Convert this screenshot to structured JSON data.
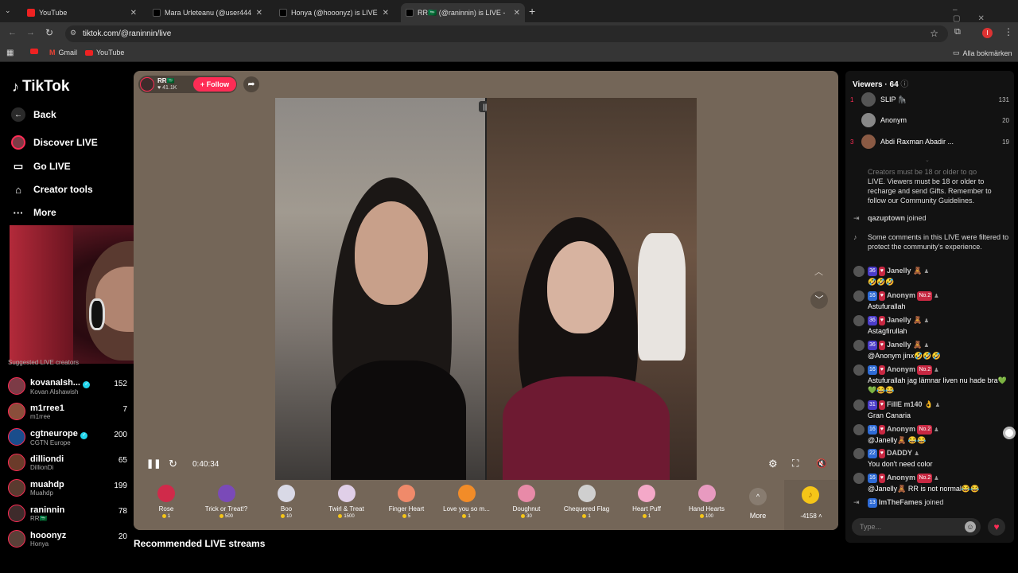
{
  "browser": {
    "tabs": [
      {
        "title": "YouTube",
        "fav": "#e22"
      },
      {
        "title": "Mara Urleteanu (@user444",
        "fav": "#222"
      },
      {
        "title": "Honya (@hooonyz) is LIVE",
        "fav": "#222"
      },
      {
        "title": "RR🇸🇦 (@raninnin) is LIVE -",
        "fav": "#222"
      }
    ],
    "url": "tiktok.com/@raninnin/live",
    "bookmarks": [
      "Gmail",
      "YouTube"
    ],
    "all_bookmarks": "Alla bokmärken",
    "profile_initial": "I"
  },
  "sidebar": {
    "logo": "TikTok",
    "back": "Back",
    "items": [
      "Discover LIVE",
      "Go LIVE",
      "Creator tools",
      "More"
    ],
    "suggested_header": "Suggested LIVE creators",
    "creators": [
      {
        "name": "kovanalsh...",
        "sub": "Kovan Alshawish",
        "count": "152",
        "verified": true,
        "color": "#7c3b46"
      },
      {
        "name": "m1rree1",
        "sub": "m1rree",
        "count": "7",
        "verified": false,
        "color": "#8a4e3b"
      },
      {
        "name": "cgtneurope",
        "sub": "CGTN Europe",
        "count": "200",
        "verified": true,
        "color": "#1a4d8c"
      },
      {
        "name": "dilliondi",
        "sub": "DillionDi",
        "count": "65",
        "verified": false,
        "color": "#6b3b2a"
      },
      {
        "name": "muahdp",
        "sub": "Muahdp",
        "count": "199",
        "verified": false,
        "color": "#5a3a2f"
      },
      {
        "name": "raninnin",
        "sub": "RR🇸🇦",
        "count": "78",
        "verified": false,
        "color": "#3e2b2b"
      },
      {
        "name": "hooonyz",
        "sub": "Honya",
        "count": "20",
        "verified": false,
        "color": "#5a4038"
      }
    ]
  },
  "player": {
    "host_name": "RR🇸🇦",
    "host_likes": "41.1K",
    "follow": "+ Follow",
    "time": "0:40:34",
    "recommended": "Recommended LIVE streams",
    "coins": "-4158",
    "gifts": [
      {
        "name": "Rose",
        "price": "1",
        "color": "#d02a4a"
      },
      {
        "name": "Trick or Treat!?",
        "price": "500",
        "color": "#7a4ab8"
      },
      {
        "name": "Boo",
        "price": "10",
        "color": "#d9d9e6"
      },
      {
        "name": "Twirl & Treat",
        "price": "1500",
        "color": "#e0cfe8"
      },
      {
        "name": "Finger Heart",
        "price": "5",
        "color": "#f08a6a"
      },
      {
        "name": "Love you so m...",
        "price": "1",
        "color": "#f28c28"
      },
      {
        "name": "Doughnut",
        "price": "30",
        "color": "#e88aa8"
      },
      {
        "name": "Chequered Flag",
        "price": "1",
        "color": "#cfcfcf"
      },
      {
        "name": "Heart Puff",
        "price": "1",
        "color": "#f4a8c8"
      },
      {
        "name": "Hand Hearts",
        "price": "100",
        "color": "#e89ac0"
      }
    ],
    "more": "More"
  },
  "chat": {
    "viewers_label": "Viewers · 64",
    "top_viewers": [
      {
        "rank": "1",
        "name": "SLIP 🦍",
        "value": "131",
        "color": "#555"
      },
      {
        "rank": "",
        "name": "Anonym",
        "value": "20",
        "color": "#888"
      },
      {
        "rank": "3",
        "name": "Abdi Raxman Abadir ...",
        "value": "19",
        "color": "#8a5a44"
      }
    ],
    "notice_faded": "Creators must be 18 or older to go",
    "notice": "LIVE. Viewers must be 18 or older to recharge and send Gifts. Remember to follow our Community Guidelines.",
    "messages": [
      {
        "kind": "join",
        "user": "qazuptown",
        "text": "joined"
      },
      {
        "kind": "system",
        "text": "Some comments in this LIVE were filtered to protect the community's experience."
      },
      {
        "kind": "msg",
        "lvl": "36",
        "user": "Janelly 🧸",
        "no": "",
        "text": "🤣🤣🤣"
      },
      {
        "kind": "msg",
        "lvl": "16",
        "user": "Anonym",
        "no": "No.2",
        "text": "Astufurallah"
      },
      {
        "kind": "msg",
        "lvl": "36",
        "user": "Janelly 🧸",
        "no": "",
        "text": "Astagfirullah"
      },
      {
        "kind": "msg",
        "lvl": "36",
        "user": "Janelly 🧸",
        "no": "",
        "text": "@Anonym jinx🤣🤣🤣"
      },
      {
        "kind": "msg",
        "lvl": "16",
        "user": "Anonym",
        "no": "No.2",
        "text": "Astufurallah jag lämnar liven nu hade bra💚💚😂😂"
      },
      {
        "kind": "msg",
        "lvl": "31",
        "user": "FillE m140 👌",
        "no": "",
        "text": "Gran Canaria"
      },
      {
        "kind": "msg",
        "lvl": "16",
        "user": "Anonym",
        "no": "No.2",
        "text": "@Janelly🧸 😂😂"
      },
      {
        "kind": "msg",
        "lvl": "22",
        "user": "DADDY",
        "no": "",
        "text": "You don't need color"
      },
      {
        "kind": "msg",
        "lvl": "16",
        "user": "Anonym",
        "no": "No.2",
        "text": "@Janelly🧸 RR is not normal😂😂"
      },
      {
        "kind": "join",
        "lvl": "13",
        "user": "ImTheFames",
        "text": "joined"
      }
    ],
    "placeholder": "Type..."
  },
  "colors": {
    "accent": "#fe2c55",
    "player_bg": "#746658"
  }
}
